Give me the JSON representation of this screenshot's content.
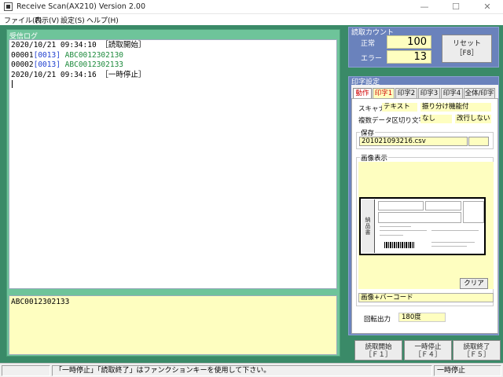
{
  "window": {
    "title": "Receive Scan(AX210) Version 2.00",
    "controls": {
      "minimize": "—",
      "maximize": "☐",
      "close": "✕"
    }
  },
  "menu": [
    {
      "label": "ファイル(F)"
    },
    {
      "label": "表示(V)"
    },
    {
      "label": "設定(S)"
    },
    {
      "label": "ヘルプ(H)"
    }
  ],
  "log_panel": {
    "title": "受信ログ",
    "lines": [
      {
        "time": "2020/10/21 09:34:10",
        "msg": "［読取開始］"
      },
      {
        "no": "00001",
        "code": "[0013]",
        "value": "ABC0012302130"
      },
      {
        "no": "00002",
        "code": "[0013]",
        "value": "ABC0012302133"
      },
      {
        "time": "2020/10/21 09:34:16",
        "msg": "［一時停止］"
      }
    ]
  },
  "scan_input": {
    "value": "ABC0012302133"
  },
  "read_count": {
    "title": "読取カウント",
    "normal_label": "正常",
    "normal_value": "100",
    "error_label": "エラー",
    "error_value": "13",
    "reset_label": "リセット",
    "reset_key": "［F8］"
  },
  "print_settings": {
    "title": "印字設定",
    "tabs": [
      "動作",
      "印字1",
      "印字2",
      "印字3",
      "印字4",
      "全体/印字"
    ],
    "scanner_label": "スキャナ",
    "scanner_value": "テキスト",
    "scanner_option": "振り分け機能付",
    "delimiter_label": "複数データ区切り文字",
    "delimiter_value": "なし",
    "newline_value": "改行しない",
    "save_group": "保存",
    "save_file": "201021093216.csv",
    "image_group": "画像表示",
    "stamp_text": "納品書",
    "clear_label": "クリア",
    "image_mode": "画像+バーコード",
    "rotation_label": "回転出力",
    "rotation_value": "180度"
  },
  "buttons": {
    "start": {
      "label": "読取開始",
      "key": "［Ｆ１］"
    },
    "pause": {
      "label": "一時停止",
      "key": "［Ｆ４］"
    },
    "stop": {
      "label": "読取終了",
      "key": "［Ｆ５］"
    }
  },
  "status": {
    "message": "「一時停止」「読取終了」はファンクションキーを使用して下さい。",
    "state": "一時停止"
  },
  "colors": {
    "main_bg": "#3a8a68",
    "log_panel": "#6ec49a",
    "side_panel": "#6a82bc",
    "input_yellow": "#fefec0",
    "active_tab": "#d00000"
  }
}
